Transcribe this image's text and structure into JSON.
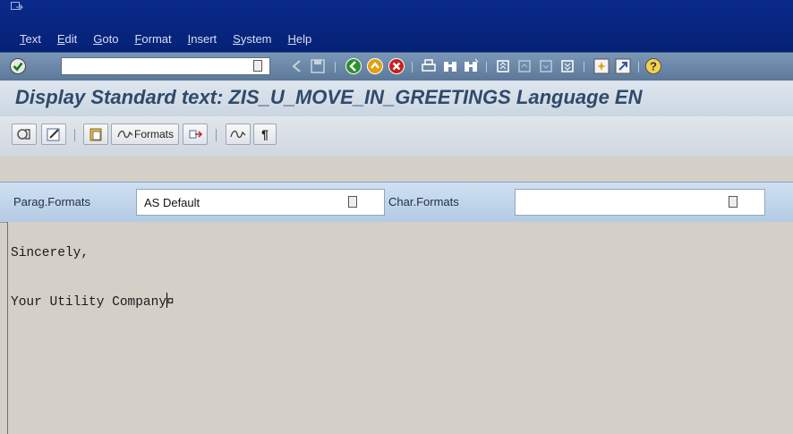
{
  "menu": {
    "items": [
      {
        "label": "Text",
        "underline": "T"
      },
      {
        "label": "Edit",
        "underline": "E"
      },
      {
        "label": "Goto",
        "underline": "G"
      },
      {
        "label": "Format",
        "underline": "F"
      },
      {
        "label": "Insert",
        "underline": "I"
      },
      {
        "label": "System",
        "underline": "S"
      },
      {
        "label": "Help",
        "underline": "H"
      }
    ]
  },
  "toolbar": {
    "command_field_value": "",
    "icons": [
      "enter-icon",
      "back-icon",
      "save-icon",
      "back-green-icon",
      "exit-icon",
      "cancel-icon",
      "print-icon",
      "find-icon",
      "find-next-icon",
      "first-page-icon",
      "previous-page-icon",
      "next-page-icon",
      "last-page-icon",
      "create-session-icon",
      "shortcut-icon",
      "help-icon"
    ]
  },
  "title": "Display Standard text: ZIS_U_MOVE_IN_GREETINGS Language EN",
  "app_toolbar": {
    "formats_label": "Formats",
    "icons": [
      "display-change-icon",
      "edit-icon",
      "clipboard-icon",
      "formats-icon",
      "move-icon",
      "format-check-icon",
      "paragraph-mark-icon"
    ]
  },
  "format_row": {
    "parag_label": "Parag.Formats",
    "parag_value": "AS Default",
    "char_label": "Char.Formats",
    "char_value": ""
  },
  "editor": {
    "lines": [
      "Sincerely,",
      "Your Utility Company"
    ],
    "end_marker": "¤"
  },
  "colors": {
    "menubar": "#0a2a8a",
    "toolbar": "#6a88aa",
    "title_text": "#2f4a6a",
    "editor_bg": "#d4d0c8"
  }
}
